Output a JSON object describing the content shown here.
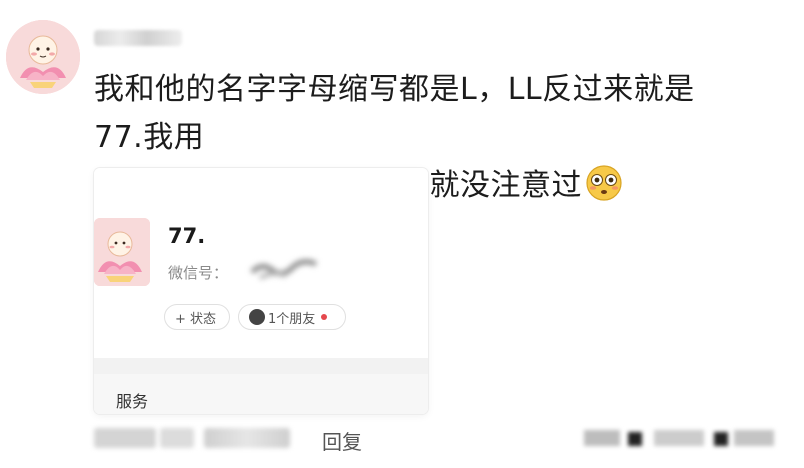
{
  "comment": {
    "line1": "我和他的名字字母缩写都是L，LL反过来就是77.我用",
    "line2": "了一年多，完了人家压根就没注意过",
    "emoji_icon": "flushed-face-emoji"
  },
  "card": {
    "name": "77.",
    "wechat_label": "微信号：",
    "status_label": "+ 状态",
    "friends_label": "1个朋友",
    "service_label": "服务"
  },
  "footer": {
    "reply_label": "回复"
  },
  "colors": {
    "red_dot": "#e5484d",
    "avatar_bg": "#f6cfcf"
  }
}
